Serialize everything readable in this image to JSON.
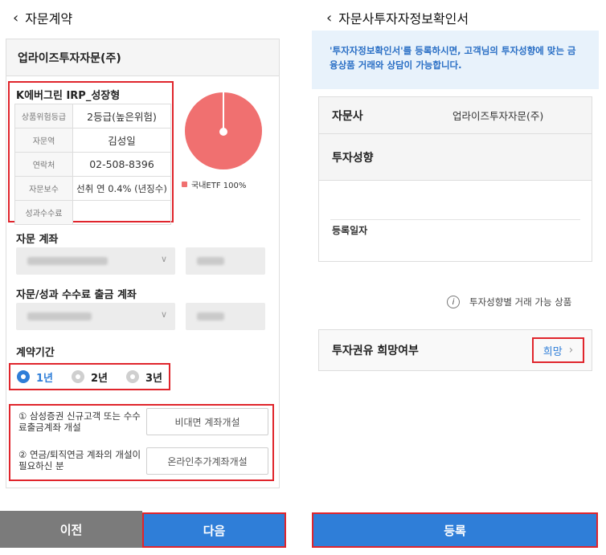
{
  "left": {
    "header": {
      "title": "자문계약"
    },
    "firm_name": "업라이즈투자자문(주)",
    "product": {
      "name": "K에버그린 IRP_성장형",
      "rows": [
        {
          "key": "상품위험등급",
          "value": "2등급(높은위험)"
        },
        {
          "key": "자문역",
          "value": "김성일"
        },
        {
          "key": "연락처",
          "value": "02-508-8396"
        },
        {
          "key": "자문보수",
          "value": "선취 연 0.4% (년징수)"
        },
        {
          "key": "성과수수료",
          "value": ""
        }
      ],
      "pie_legend": "국내ETF 100%",
      "pie_color": "#f07070"
    },
    "advisory_account_label": "자문 계좌",
    "fee_account_label": "자문/성과 수수료 출금 계좌",
    "period_label": "계약기간",
    "period_options": [
      "1년",
      "2년",
      "3년"
    ],
    "period_selected": "1년",
    "info": [
      {
        "text": "① 삼성증권 신규고객 또는 수수료출금계좌 개설",
        "button": "비대면 계좌개설"
      },
      {
        "text": "② 연금/퇴직연금 계좌의 개설이 필요하신 분",
        "button": "온라인추가계좌개설"
      }
    ],
    "prev_button": "이전",
    "next_button": "다음"
  },
  "right": {
    "header": {
      "title": "자문사투자자정보확인서"
    },
    "notice": "'투자자정보확인서'를 등록하시면, 고객님의 투자성향에 맞는 금융상품 거래와 상담이 가능합니다.",
    "advisor_label": "자문사",
    "advisor_value": "업라이즈투자자문(주)",
    "propensity_label": "투자성향",
    "reg_date_label": "등록일자",
    "tradable_link": "투자성향별 거래 가능 상품",
    "solicit_label": "투자권유 희망여부",
    "solicit_value": "희망",
    "register_button": "등록"
  },
  "colors": {
    "accent": "#2f7ed8",
    "highlight": "#e0252c",
    "prev_bg": "#7b7b7b"
  }
}
